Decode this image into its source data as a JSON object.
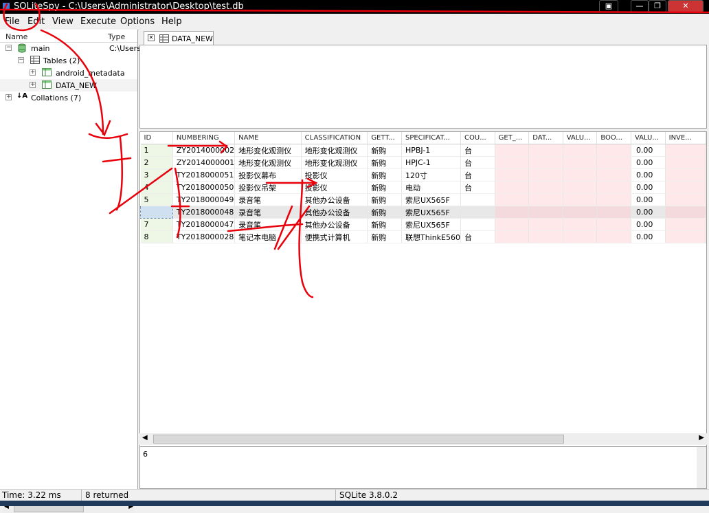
{
  "window": {
    "title": "SQLiteSpy - C:\\Users\\Administrator\\Desktop\\test.db"
  },
  "menu": [
    "File",
    "Edit",
    "View",
    "Execute",
    "Options",
    "Help"
  ],
  "tree": {
    "header_name": "Name",
    "header_type": "Type",
    "db_name": "main",
    "db_path": "C:\\Users",
    "tables_label": "Tables (2)",
    "table_1": "android_metadata",
    "table_2": "DATA_NEW",
    "collations_label": "Collations (7)"
  },
  "tab": {
    "label": "DATA_NEW"
  },
  "grid": {
    "columns": [
      "ID",
      "NUMBERING",
      "NAME",
      "CLASSIFICATION",
      "GETT...",
      "SPECIFICAT...",
      "COU...",
      "GET_...",
      "DAT...",
      "VALU...",
      "BOO...",
      "VALU...",
      "INVE..."
    ],
    "rows": [
      [
        "1",
        "ZY2014000002",
        "地形变化观测仪",
        "地形变化观测仪",
        "新购",
        "HPBJ-1",
        "台",
        "",
        "",
        "",
        "",
        "0.00",
        ""
      ],
      [
        "2",
        "ZY2014000001",
        "地形变化观测仪",
        "地形变化观测仪",
        "新购",
        "HPJC-1",
        "台",
        "",
        "",
        "",
        "",
        "0.00",
        ""
      ],
      [
        "3",
        "TY2018000051",
        "投影仪幕布",
        "投影仪",
        "新购",
        "120寸",
        "台",
        "",
        "",
        "",
        "",
        "0.00",
        ""
      ],
      [
        "4",
        "TY2018000050",
        "投影仪吊架",
        "投影仪",
        "新购",
        "电动",
        "台",
        "",
        "",
        "",
        "",
        "0.00",
        ""
      ],
      [
        "5",
        "TY2018000049",
        "录音笔",
        "其他办公设备",
        "新购",
        "索尼UX565F",
        "",
        "",
        "",
        "",
        "",
        "0.00",
        ""
      ],
      [
        "",
        "TY2018000048",
        "录音笔",
        "其他办公设备",
        "新购",
        "索尼UX565F",
        "",
        "",
        "",
        "",
        "",
        "0.00",
        ""
      ],
      [
        "7",
        "TY2018000047",
        "录音笔",
        "其他办公设备",
        "新购",
        "索尼UX565F",
        "",
        "",
        "",
        "",
        "",
        "0.00",
        ""
      ],
      [
        "8",
        "TY2018000028",
        "笔记本电脑",
        "便携式计算机",
        "新购",
        "联想ThinkE560",
        "台",
        "",
        "",
        "",
        "",
        "0.00",
        ""
      ]
    ],
    "selected_row_index": 5
  },
  "log": {
    "text": "6"
  },
  "status": {
    "time": "Time: 3.22 ms",
    "returned": "8 returned",
    "version": "SQLite 3.8.0.2"
  },
  "colors": {
    "annotation_red": "#e8000b",
    "id_column_bg": "#eef7e6",
    "empty_cell_bg": "#ffe8ea"
  }
}
